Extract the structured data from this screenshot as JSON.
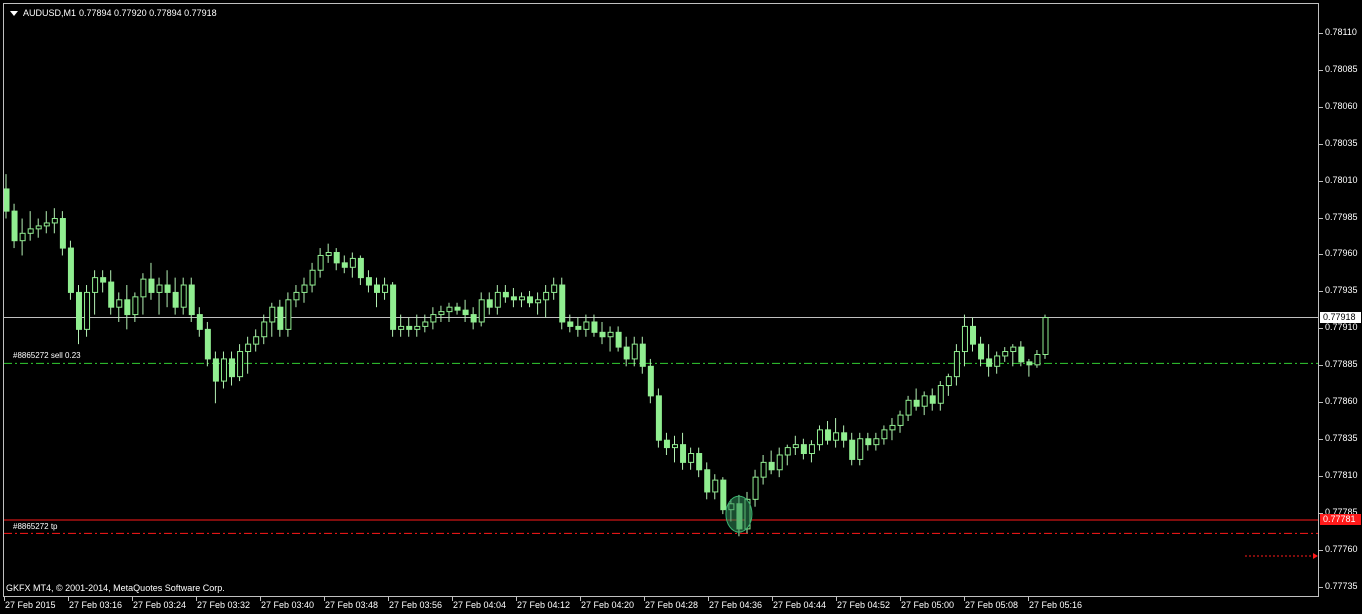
{
  "window": {
    "symbol": "AUDUSD,M1",
    "ohlc": "0.77894 0.77920 0.77894 0.77918",
    "copyright": "GKFX MT4, © 2001-2014, MetaQuotes Software Corp."
  },
  "orders": {
    "sell_label": "#8865272 sell 0.23",
    "tp_label": "#8865272 tp",
    "sell_price": 0.77887,
    "tp_price": 0.77772
  },
  "markers": {
    "bid": "0.77918",
    "ask": "0.77781"
  },
  "colors": {
    "background": "#000000",
    "bull_candle": "#ffffff",
    "bear_candle": "#90ee90",
    "wick": "#b4f0b4",
    "bid_line": "#c0c0c0",
    "ask_line": "#ff1a1a",
    "sell_line": "#32cd32",
    "tp_line": "#ff1a1a"
  },
  "chart_data": {
    "type": "candlestick",
    "ylim": [
      0.77735,
      0.7812
    ],
    "y_ticks": [
      "0.78110",
      "0.78085",
      "0.78060",
      "0.78035",
      "0.78010",
      "0.77985",
      "0.77960",
      "0.77935",
      "0.77910",
      "0.77885",
      "0.77860",
      "0.77835",
      "0.77810",
      "0.77785",
      "0.77760",
      "0.77735"
    ],
    "x_labels": [
      "27 Feb 2015",
      "27 Feb 03:16",
      "27 Feb 03:24",
      "27 Feb 03:32",
      "27 Feb 03:40",
      "27 Feb 03:48",
      "27 Feb 03:56",
      "27 Feb 04:04",
      "27 Feb 04:12",
      "27 Feb 04:20",
      "27 Feb 04:28",
      "27 Feb 04:36",
      "27 Feb 04:44",
      "27 Feb 04:52",
      "27 Feb 05:00",
      "27 Feb 05:08",
      "27 Feb 05:16"
    ],
    "bid": 0.77918,
    "ask": 0.77781,
    "candles": [
      [
        0.78005,
        0.78015,
        0.77985,
        0.7799
      ],
      [
        0.7799,
        0.77995,
        0.77965,
        0.7797
      ],
      [
        0.7797,
        0.77985,
        0.7796,
        0.77975
      ],
      [
        0.77975,
        0.7799,
        0.7797,
        0.77978
      ],
      [
        0.77978,
        0.77985,
        0.77972,
        0.7798
      ],
      [
        0.7798,
        0.7799,
        0.77975,
        0.77982
      ],
      [
        0.77982,
        0.77992,
        0.77975,
        0.77985
      ],
      [
        0.77985,
        0.7799,
        0.7796,
        0.77965
      ],
      [
        0.77965,
        0.7797,
        0.7793,
        0.77935
      ],
      [
        0.77935,
        0.7794,
        0.779,
        0.7791
      ],
      [
        0.7791,
        0.7794,
        0.77905,
        0.77935
      ],
      [
        0.77935,
        0.7795,
        0.7792,
        0.77945
      ],
      [
        0.77945,
        0.7795,
        0.77935,
        0.77942
      ],
      [
        0.77942,
        0.7795,
        0.7792,
        0.77925
      ],
      [
        0.77925,
        0.77935,
        0.77915,
        0.7793
      ],
      [
        0.7793,
        0.7794,
        0.7791,
        0.7792
      ],
      [
        0.7792,
        0.77935,
        0.77915,
        0.77932
      ],
      [
        0.77932,
        0.77948,
        0.7792,
        0.77944
      ],
      [
        0.77944,
        0.77955,
        0.7793,
        0.77935
      ],
      [
        0.77935,
        0.77945,
        0.7792,
        0.7794
      ],
      [
        0.7794,
        0.7795,
        0.77925,
        0.77935
      ],
      [
        0.77935,
        0.77945,
        0.7792,
        0.77925
      ],
      [
        0.77925,
        0.77945,
        0.7792,
        0.7794
      ],
      [
        0.7794,
        0.77945,
        0.77915,
        0.7792
      ],
      [
        0.7792,
        0.77925,
        0.77905,
        0.7791
      ],
      [
        0.7791,
        0.77915,
        0.77885,
        0.7789
      ],
      [
        0.7789,
        0.77895,
        0.7786,
        0.77875
      ],
      [
        0.77875,
        0.77895,
        0.7787,
        0.7789
      ],
      [
        0.7789,
        0.77895,
        0.77872,
        0.77878
      ],
      [
        0.77878,
        0.779,
        0.77875,
        0.77895
      ],
      [
        0.77895,
        0.77905,
        0.7788,
        0.779
      ],
      [
        0.779,
        0.7791,
        0.77895,
        0.77905
      ],
      [
        0.77905,
        0.7792,
        0.779,
        0.77915
      ],
      [
        0.77915,
        0.77928,
        0.77905,
        0.77925
      ],
      [
        0.77925,
        0.7793,
        0.77905,
        0.7791
      ],
      [
        0.7791,
        0.77935,
        0.77905,
        0.7793
      ],
      [
        0.7793,
        0.7794,
        0.77925,
        0.77935
      ],
      [
        0.77935,
        0.77945,
        0.77928,
        0.7794
      ],
      [
        0.7794,
        0.77955,
        0.77935,
        0.7795
      ],
      [
        0.7795,
        0.77965,
        0.77945,
        0.7796
      ],
      [
        0.7796,
        0.77968,
        0.77955,
        0.77962
      ],
      [
        0.77962,
        0.77965,
        0.7795,
        0.77955
      ],
      [
        0.77955,
        0.7796,
        0.77948,
        0.77952
      ],
      [
        0.77952,
        0.77962,
        0.77945,
        0.77958
      ],
      [
        0.77958,
        0.7796,
        0.7794,
        0.77945
      ],
      [
        0.77945,
        0.7795,
        0.77935,
        0.7794
      ],
      [
        0.7794,
        0.77945,
        0.77925,
        0.77935
      ],
      [
        0.77935,
        0.77945,
        0.7793,
        0.7794
      ],
      [
        0.7794,
        0.77942,
        0.77905,
        0.7791
      ],
      [
        0.7791,
        0.7792,
        0.77905,
        0.77912
      ],
      [
        0.77912,
        0.77918,
        0.77905,
        0.7791
      ],
      [
        0.7791,
        0.7792,
        0.77905,
        0.77912
      ],
      [
        0.77912,
        0.7792,
        0.77908,
        0.77915
      ],
      [
        0.77915,
        0.77925,
        0.7791,
        0.7792
      ],
      [
        0.7792,
        0.77926,
        0.77915,
        0.77922
      ],
      [
        0.77922,
        0.77928,
        0.77915,
        0.77925
      ],
      [
        0.77925,
        0.77928,
        0.7792,
        0.77923
      ],
      [
        0.77923,
        0.7793,
        0.77915,
        0.7792
      ],
      [
        0.7792,
        0.77925,
        0.7791,
        0.77915
      ],
      [
        0.77915,
        0.77935,
        0.77912,
        0.7793
      ],
      [
        0.7793,
        0.77935,
        0.7792,
        0.77925
      ],
      [
        0.77925,
        0.7794,
        0.7792,
        0.77935
      ],
      [
        0.77935,
        0.7794,
        0.77928,
        0.77932
      ],
      [
        0.77932,
        0.77938,
        0.77925,
        0.7793
      ],
      [
        0.7793,
        0.77935,
        0.77925,
        0.77932
      ],
      [
        0.77932,
        0.77936,
        0.77925,
        0.77928
      ],
      [
        0.77928,
        0.77935,
        0.7792,
        0.7793
      ],
      [
        0.7793,
        0.7794,
        0.77918,
        0.77935
      ],
      [
        0.77935,
        0.77945,
        0.7793,
        0.7794
      ],
      [
        0.7794,
        0.77945,
        0.7791,
        0.77915
      ],
      [
        0.77915,
        0.7792,
        0.77908,
        0.77912
      ],
      [
        0.77912,
        0.77918,
        0.77905,
        0.7791
      ],
      [
        0.7791,
        0.7792,
        0.77905,
        0.77915
      ],
      [
        0.77915,
        0.7792,
        0.77905,
        0.77908
      ],
      [
        0.77908,
        0.77915,
        0.779,
        0.77905
      ],
      [
        0.77905,
        0.77912,
        0.77895,
        0.77908
      ],
      [
        0.77908,
        0.77912,
        0.77895,
        0.77898
      ],
      [
        0.77898,
        0.77905,
        0.77885,
        0.7789
      ],
      [
        0.7789,
        0.77905,
        0.77885,
        0.779
      ],
      [
        0.779,
        0.77905,
        0.7788,
        0.77885
      ],
      [
        0.77885,
        0.7789,
        0.7786,
        0.77865
      ],
      [
        0.77865,
        0.7787,
        0.7783,
        0.77835
      ],
      [
        0.77835,
        0.7784,
        0.77825,
        0.7783
      ],
      [
        0.7783,
        0.77838,
        0.7782,
        0.77832
      ],
      [
        0.77832,
        0.7784,
        0.77815,
        0.7782
      ],
      [
        0.7782,
        0.7783,
        0.77815,
        0.77826
      ],
      [
        0.77826,
        0.7783,
        0.7781,
        0.77815
      ],
      [
        0.77815,
        0.7782,
        0.77795,
        0.778
      ],
      [
        0.778,
        0.77812,
        0.77795,
        0.77808
      ],
      [
        0.77808,
        0.7781,
        0.77785,
        0.77788
      ],
      [
        0.77788,
        0.77795,
        0.7778,
        0.77792
      ],
      [
        0.77792,
        0.77798,
        0.7777,
        0.77775
      ],
      [
        0.77775,
        0.778,
        0.77772,
        0.77795
      ],
      [
        0.77795,
        0.77815,
        0.7779,
        0.7781
      ],
      [
        0.7781,
        0.77825,
        0.77805,
        0.7782
      ],
      [
        0.7782,
        0.77828,
        0.77812,
        0.77815
      ],
      [
        0.77815,
        0.7783,
        0.7781,
        0.77825
      ],
      [
        0.77825,
        0.77832,
        0.77818,
        0.7783
      ],
      [
        0.7783,
        0.77838,
        0.77825,
        0.77832
      ],
      [
        0.77832,
        0.77836,
        0.77822,
        0.77826
      ],
      [
        0.77826,
        0.77835,
        0.7782,
        0.77832
      ],
      [
        0.77832,
        0.77845,
        0.77828,
        0.77842
      ],
      [
        0.77842,
        0.77848,
        0.77832,
        0.77835
      ],
      [
        0.77835,
        0.7785,
        0.7783,
        0.7784
      ],
      [
        0.7784,
        0.77845,
        0.7783,
        0.77835
      ],
      [
        0.77835,
        0.7784,
        0.77818,
        0.77822
      ],
      [
        0.77822,
        0.7784,
        0.77818,
        0.77836
      ],
      [
        0.77836,
        0.7784,
        0.77828,
        0.77832
      ],
      [
        0.77832,
        0.7784,
        0.77828,
        0.77836
      ],
      [
        0.77836,
        0.77845,
        0.77832,
        0.77842
      ],
      [
        0.77842,
        0.7785,
        0.77835,
        0.77845
      ],
      [
        0.77845,
        0.77855,
        0.7784,
        0.77852
      ],
      [
        0.77852,
        0.77865,
        0.77848,
        0.77862
      ],
      [
        0.77862,
        0.7787,
        0.77855,
        0.77858
      ],
      [
        0.77858,
        0.77868,
        0.77852,
        0.77865
      ],
      [
        0.77865,
        0.7787,
        0.77855,
        0.7786
      ],
      [
        0.7786,
        0.77875,
        0.77855,
        0.77872
      ],
      [
        0.77872,
        0.7788,
        0.77865,
        0.77878
      ],
      [
        0.77878,
        0.779,
        0.77872,
        0.77895
      ],
      [
        0.77895,
        0.7792,
        0.77885,
        0.77912
      ],
      [
        0.77912,
        0.77918,
        0.77895,
        0.779
      ],
      [
        0.779,
        0.77905,
        0.77885,
        0.7789
      ],
      [
        0.7789,
        0.779,
        0.77878,
        0.77885
      ],
      [
        0.77885,
        0.77895,
        0.7788,
        0.77892
      ],
      [
        0.77892,
        0.77898,
        0.77888,
        0.77895
      ],
      [
        0.77895,
        0.779,
        0.77885,
        0.77898
      ],
      [
        0.77898,
        0.77902,
        0.77885,
        0.77888
      ],
      [
        0.77888,
        0.7789,
        0.77878,
        0.77886
      ],
      [
        0.77886,
        0.77896,
        0.77884,
        0.77893
      ],
      [
        0.77893,
        0.7792,
        0.7789,
        0.77918
      ]
    ]
  }
}
